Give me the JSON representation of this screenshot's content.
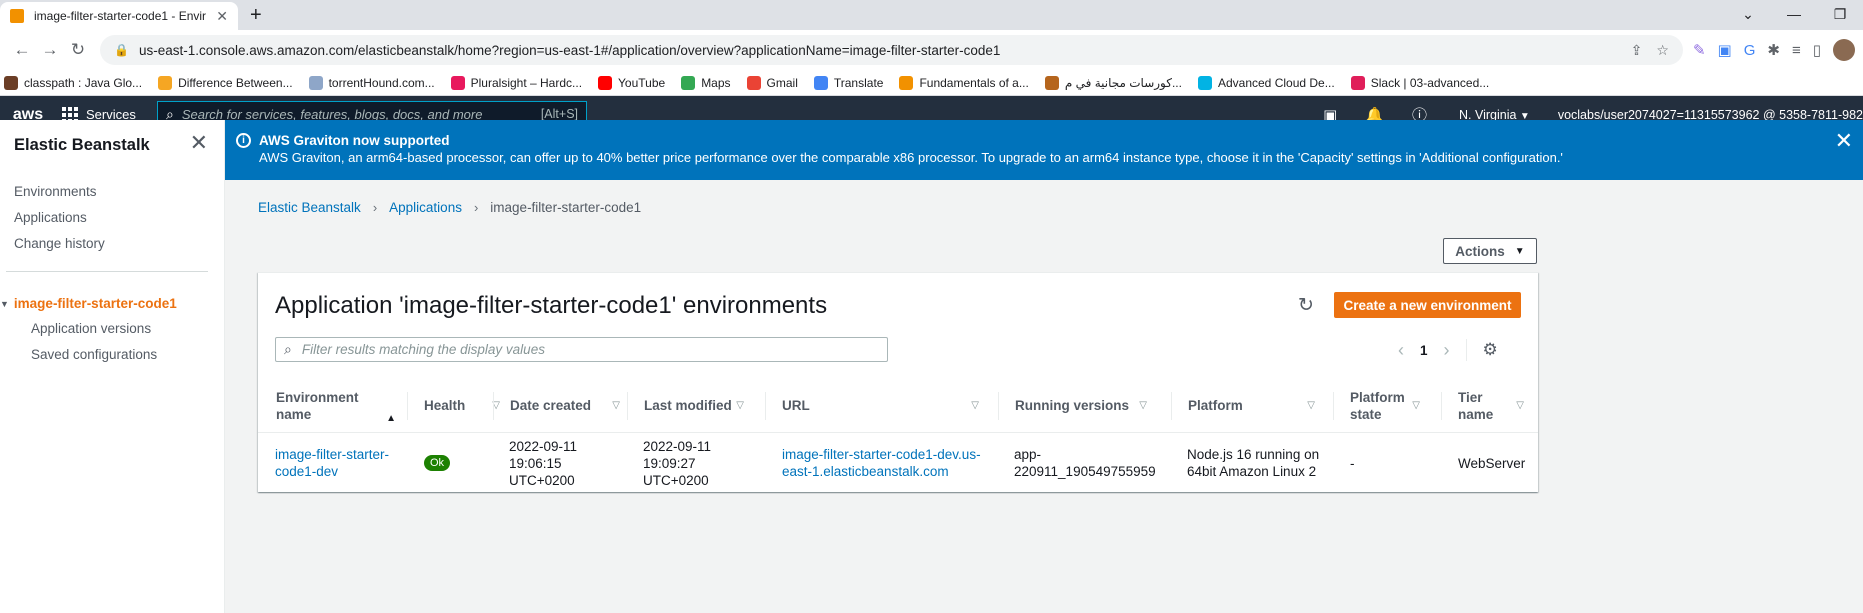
{
  "browser": {
    "tab_title": "image-filter-starter-code1 - Envir",
    "url": "us-east-1.console.aws.amazon.com/elasticbeanstalk/home?region=us-east-1#/application/overview?applicationName=image-filter-starter-code1",
    "bookmarks": [
      {
        "label": "classpath : Java Glo...",
        "color": "#6b3e26"
      },
      {
        "label": "Difference Between...",
        "color": "#f5a623"
      },
      {
        "label": "torrentHound.com...",
        "color": "#8ea6c8"
      },
      {
        "label": "Pluralsight – Hardc...",
        "color": "#e8195d"
      },
      {
        "label": "YouTube",
        "color": "#ff0000"
      },
      {
        "label": "Maps",
        "color": "#34a853"
      },
      {
        "label": "Gmail",
        "color": "#ea4335"
      },
      {
        "label": "Translate",
        "color": "#4285f4"
      },
      {
        "label": "Fundamentals of a...",
        "color": "#f29100"
      },
      {
        "label": "كورسات مجانية في م...",
        "color": "#b5651d"
      },
      {
        "label": "Advanced Cloud De...",
        "color": "#02b3e4"
      },
      {
        "label": "Slack | 03-advanced...",
        "color": "#e01e5a"
      }
    ]
  },
  "aws_nav": {
    "logo": "aws",
    "services": "Services",
    "search_placeholder": "Search for services, features, blogs, docs, and more",
    "search_shortcut": "[Alt+S]",
    "region": "N. Virginia",
    "user": "voclabs/user2074027=11315573962 @ 5358-7811-982"
  },
  "sidebar": {
    "title": "Elastic Beanstalk",
    "links": [
      "Environments",
      "Applications",
      "Change history"
    ],
    "app_name": "image-filter-starter-code1",
    "sub_links": [
      "Application versions",
      "Saved configurations"
    ]
  },
  "banner": {
    "title": "AWS Graviton now supported",
    "body": "AWS Graviton, an arm64-based processor, can offer up to 40% better price performance over the comparable x86 processor. To upgrade to an arm64 instance type, choose it in the 'Capacity' settings in 'Additional configuration.'"
  },
  "breadcrumb": {
    "items": [
      "Elastic Beanstalk",
      "Applications"
    ],
    "current": "image-filter-starter-code1"
  },
  "actions_label": "Actions",
  "panel": {
    "title": "Application 'image-filter-starter-code1' environments",
    "create_label": "Create a new environment",
    "filter_placeholder": "Filter results matching the display values",
    "page": "1"
  },
  "table": {
    "headers": [
      "Environment name",
      "Health",
      "Date created",
      "Last modified",
      "URL",
      "Running versions",
      "Platform",
      "Platform state",
      "Tier name"
    ],
    "row": {
      "env_name": "image-filter-starter-code1-dev",
      "health": "Ok",
      "date_created": "2022-09-11 19:06:15 UTC+0200",
      "last_modified": "2022-09-11 19:09:27 UTC+0200",
      "url": "image-filter-starter-code1-dev.us-east-1.elasticbeanstalk.com",
      "running_version": "app-220911_190549755959",
      "platform": "Node.js 16 running on 64bit Amazon Linux 2",
      "platform_state": "-",
      "tier": "WebServer"
    }
  },
  "colors": {
    "aws_nav": "#232f3e",
    "banner": "#0073bb",
    "primary_button": "#ec7211",
    "link": "#0073bb",
    "health_ok": "#1d8102"
  }
}
